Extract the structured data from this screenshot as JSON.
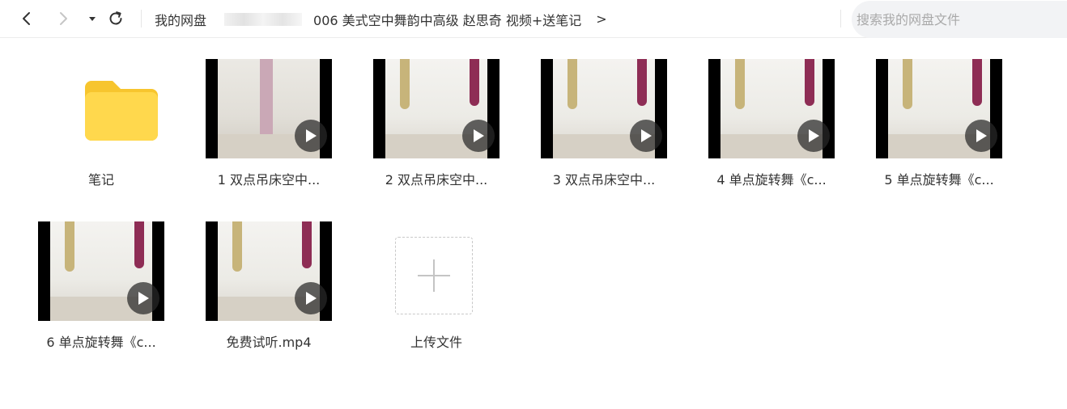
{
  "toolbar": {
    "back_icon": "chevron-left-icon",
    "forward_icon": "chevron-right-icon",
    "dropdown_icon": "caret-down-icon",
    "refresh_icon": "refresh-icon"
  },
  "breadcrumb": {
    "root": "我的网盘",
    "current": "006 美式空中舞韵中高级 赵思奇  视频+送笔记",
    "more": ">"
  },
  "search": {
    "placeholder": "搜索我的网盘文件"
  },
  "colors": {
    "folder": "#ffd84d",
    "folder_back": "#f7c52e",
    "play_overlay": "#282828"
  },
  "files": [
    {
      "name": "笔记",
      "type": "folder",
      "icon": "folder-icon"
    },
    {
      "name": "1 双点吊床空中...",
      "type": "video",
      "icon": "play-icon"
    },
    {
      "name": "2 双点吊床空中...",
      "type": "video",
      "icon": "play-icon"
    },
    {
      "name": "3 双点吊床空中...",
      "type": "video",
      "icon": "play-icon"
    },
    {
      "name": "4 单点旋转舞《c...",
      "type": "video",
      "icon": "play-icon"
    },
    {
      "name": "5 单点旋转舞《c...",
      "type": "video",
      "icon": "play-icon"
    },
    {
      "name": "6 单点旋转舞《c...",
      "type": "video",
      "icon": "play-icon"
    },
    {
      "name": "免费试听.mp4",
      "type": "video",
      "icon": "play-icon"
    },
    {
      "name": "上传文件",
      "type": "upload",
      "icon": "plus-icon"
    }
  ]
}
